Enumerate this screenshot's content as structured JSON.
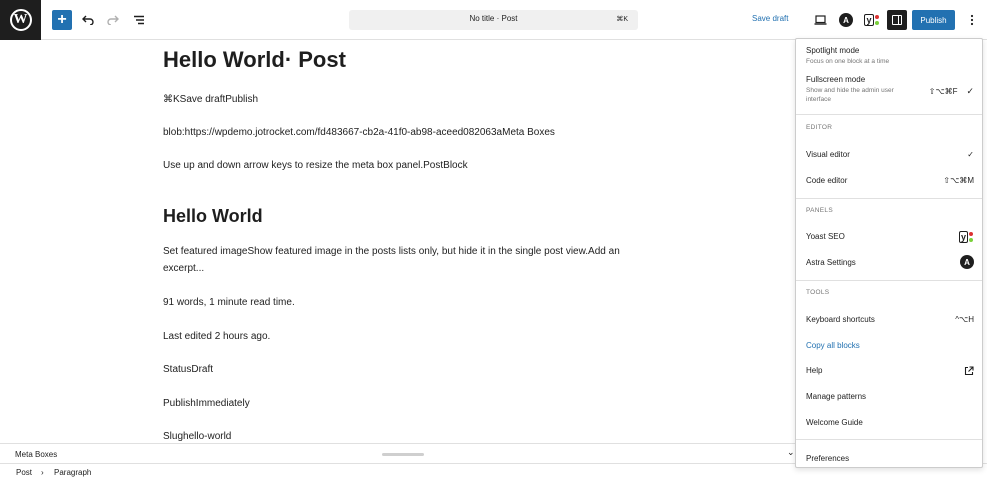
{
  "toolbar": {
    "doc_title": "No title · Post",
    "doc_shortcut": "⌘K",
    "save_draft": "Save draft",
    "publish": "Publish",
    "undo_icon": "undo-icon",
    "redo_icon": "redo-icon",
    "list_view_icon": "list-view-icon",
    "preview_icon": "laptop-icon",
    "astra_letter": "A",
    "yoast_letter": "y",
    "more_icon": "more-vertical-icon",
    "accent": "#2271b1"
  },
  "content": {
    "post_title": "Hello World· Post",
    "lines": [
      "⌘KSave draftPublish",
      "blob:https://wpdemo.jotrocket.com/fd483667-cb2a-41f0-ab98-aceed082063aMeta Boxes",
      "Use up and down arrow keys to resize the meta box panel.PostBlock"
    ],
    "heading": "Hello World",
    "paragraphs": [
      "Set featured imageShow featured image in the posts lists only, but hide it in the single post view.Add an excerpt...",
      "91 words, 1 minute read time.",
      "Last edited 2 hours ago.",
      "StatusDraft",
      "PublishImmediately",
      "Slughello-world"
    ]
  },
  "metabox": {
    "label": "Meta Boxes"
  },
  "breadcrumb": {
    "items": [
      "Post",
      "Paragraph"
    ],
    "separator": "›"
  },
  "menu": {
    "spotlight": {
      "label": "Spotlight mode",
      "desc": "Focus on one block at a time"
    },
    "fullscreen": {
      "label": "Fullscreen mode",
      "desc": "Show and hide the admin user interface",
      "shortcut": "⇧⌥⌘F",
      "check": "✓"
    },
    "editor_section": "EDITOR",
    "visual_editor": {
      "label": "Visual editor",
      "check": "✓"
    },
    "code_editor": {
      "label": "Code editor",
      "shortcut": "⇧⌥⌘M"
    },
    "panels_section": "PANELS",
    "yoast": {
      "label": "Yoast SEO"
    },
    "astra": {
      "label": "Astra Settings"
    },
    "tools_section": "TOOLS",
    "keyboard": {
      "label": "Keyboard shortcuts",
      "shortcut": "^⌥H"
    },
    "copy_blocks": {
      "label": "Copy all blocks"
    },
    "help": {
      "label": "Help"
    },
    "patterns": {
      "label": "Manage patterns"
    },
    "welcome": {
      "label": "Welcome Guide"
    },
    "preferences": {
      "label": "Preferences"
    }
  }
}
